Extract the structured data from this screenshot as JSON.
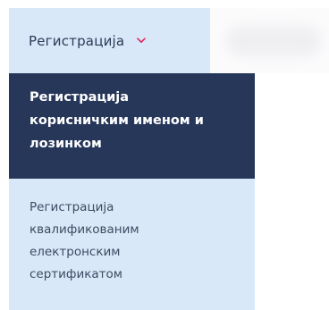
{
  "nav": {
    "tab_label": "Регистрација",
    "tab_icon": "chevron-down-icon",
    "accent_color": "#e0245e"
  },
  "dropdown": {
    "items": [
      {
        "label": "Регистрација\nкорисничким именом и\nлозинком",
        "active": true
      },
      {
        "label": "Регистрација\nквалификованим\nелектронским\nсертификатом",
        "active": false
      }
    ]
  },
  "colors": {
    "menu_background": "#d9e8f8",
    "active_item_background": "#27375a",
    "active_item_text": "#ffffff",
    "item_text": "#3e4a63"
  }
}
